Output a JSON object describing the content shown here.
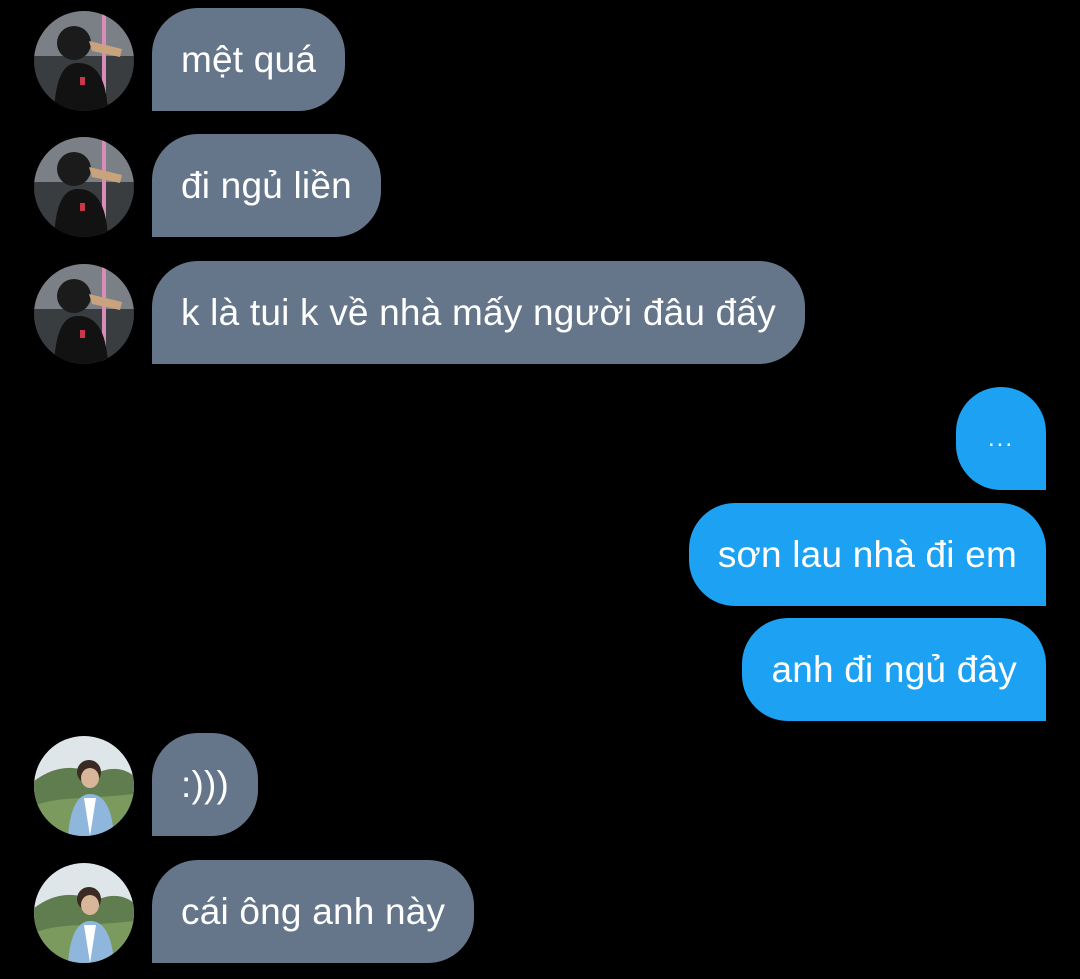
{
  "conversation": {
    "messages": [
      {
        "sender": "other",
        "text": "mệt quá"
      },
      {
        "sender": "other",
        "text": "đi ngủ liền"
      },
      {
        "sender": "other",
        "text": "k là tui k về nhà mấy người đâu đấy"
      },
      {
        "sender": "me",
        "text": "..."
      },
      {
        "sender": "me",
        "text": "sơn lau nhà đi em"
      },
      {
        "sender": "me",
        "text": "anh đi ngủ đây"
      },
      {
        "sender": "other2",
        "text": ":)))"
      },
      {
        "sender": "other2",
        "text": "cái ông anh này"
      }
    ]
  },
  "colors": {
    "background": "#000000",
    "incoming_bubble": "#66768a",
    "outgoing_bubble": "#1da1f2",
    "text": "#ffffff"
  },
  "icons": {
    "avatar_1": "avatar-dark-shirt-photo",
    "avatar_2": "avatar-outdoor-hills-photo"
  }
}
